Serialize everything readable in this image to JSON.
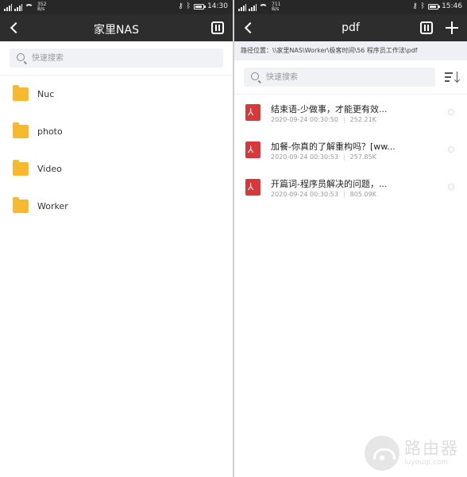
{
  "left": {
    "status": {
      "net_speed_value": "352",
      "net_speed_unit": "B/s",
      "time": "14:30"
    },
    "title": "家里NAS",
    "search": {
      "placeholder": "快速搜索"
    },
    "folders": [
      {
        "name": "Nuc"
      },
      {
        "name": "photo"
      },
      {
        "name": "Video"
      },
      {
        "name": "Worker"
      }
    ]
  },
  "right": {
    "status": {
      "net_speed_value": "711",
      "net_speed_unit": "B/s",
      "time": "15:46"
    },
    "title": "pdf",
    "path": {
      "label": "路径位置：",
      "value": "\\\\家里NAS\\Worker\\极客时间\\56 程序员工作法\\pdf"
    },
    "search": {
      "placeholder": "快速搜索"
    },
    "files": [
      {
        "name": "结束语-少做事，才能更有效...",
        "date": "2020-09-24 00:30:50",
        "size": "252.21K"
      },
      {
        "name": "加餐-你真的了解重构吗？[ww...",
        "date": "2020-09-24 00:30:53",
        "size": "257.85K"
      },
      {
        "name": "开篇词-程序员解决的问题，...",
        "date": "2020-09-24 00:30:53",
        "size": "805.09K"
      }
    ]
  },
  "watermark": {
    "cn": "路由器",
    "en": "luyouqi.com"
  },
  "colors": {
    "folder": "#f8b931",
    "pdf": "#d9383a",
    "titlebar": "#2d2d2d",
    "statusbar": "#272727"
  },
  "icons": [
    "back-arrow-icon",
    "sort-icon",
    "plus-icon",
    "search-icon",
    "folder-icon",
    "pdf-file-icon",
    "sort-list-icon",
    "wifi-icon",
    "signal-icon",
    "battery-icon",
    "bluetooth-icon",
    "key-icon"
  ]
}
